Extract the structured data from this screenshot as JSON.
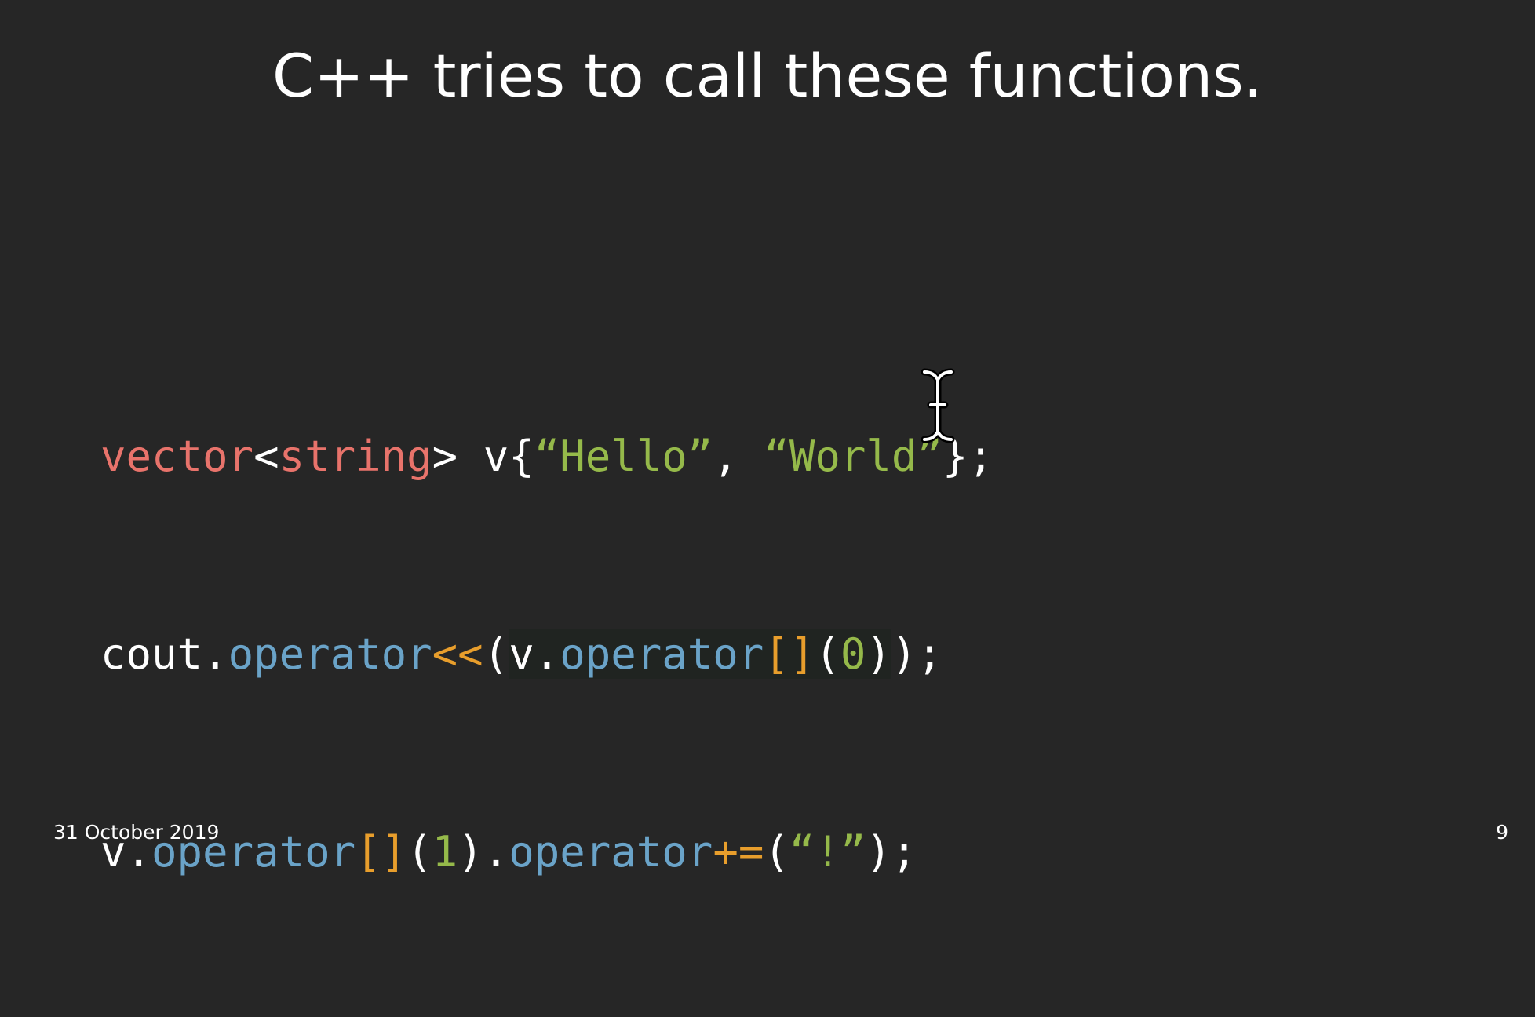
{
  "slide": {
    "title": "C++ tries to call these functions.",
    "footer_date": "31 October 2019",
    "page_number": "9"
  },
  "code": {
    "line1": [
      {
        "text": "vector",
        "color": "#e8736b"
      },
      {
        "text": "<",
        "color": "#ffffff"
      },
      {
        "text": "string",
        "color": "#e8736b"
      },
      {
        "text": "> v{",
        "color": "#ffffff"
      },
      {
        "text": "“Hello”",
        "color": "#95b94a"
      },
      {
        "text": ", ",
        "color": "#ffffff"
      },
      {
        "text": "“World”",
        "color": "#95b94a"
      },
      {
        "text": "};",
        "color": "#ffffff"
      }
    ],
    "line2": [
      {
        "text": "cout.",
        "color": "#ffffff"
      },
      {
        "text": "operator",
        "color": "#6aa3c8"
      },
      {
        "text": "<<",
        "color": "#e89e2c"
      },
      {
        "text": "(",
        "color": "#ffffff"
      },
      {
        "text": "v.",
        "color": "#ffffff",
        "highlight": true
      },
      {
        "text": "operator",
        "color": "#6aa3c8",
        "highlight": true
      },
      {
        "text": "[]",
        "color": "#e89e2c",
        "highlight": true
      },
      {
        "text": "(",
        "color": "#ffffff",
        "highlight": true
      },
      {
        "text": "0",
        "color": "#95b94a",
        "highlight": true
      },
      {
        "text": ")",
        "color": "#ffffff",
        "highlight": true
      },
      {
        "text": ");",
        "color": "#ffffff"
      }
    ],
    "line3": [
      {
        "text": "v.",
        "color": "#ffffff"
      },
      {
        "text": "operator",
        "color": "#6aa3c8"
      },
      {
        "text": "[]",
        "color": "#e89e2c"
      },
      {
        "text": "(",
        "color": "#ffffff"
      },
      {
        "text": "1",
        "color": "#95b94a"
      },
      {
        "text": ").",
        "color": "#ffffff"
      },
      {
        "text": "operator",
        "color": "#6aa3c8"
      },
      {
        "text": "+=",
        "color": "#e89e2c"
      },
      {
        "text": "(",
        "color": "#ffffff"
      },
      {
        "text": "“!”",
        "color": "#95b94a"
      },
      {
        "text": ");",
        "color": "#ffffff"
      }
    ]
  },
  "colors": {
    "background": "#262626",
    "keyword_type": "#e8736b",
    "method": "#6aa3c8",
    "operator_symbol": "#e89e2c",
    "literal": "#95b94a",
    "plain": "#ffffff"
  },
  "icons": {
    "cursor": "text-cursor-icon"
  }
}
